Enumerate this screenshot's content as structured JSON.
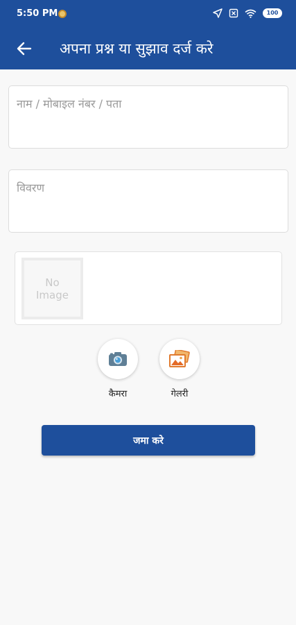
{
  "status_bar": {
    "time": "5:50 PM",
    "battery": "100",
    "icons": [
      "notification-dot-icon",
      "location-arrow-icon",
      "sim-off-icon",
      "wifi-icon",
      "battery-icon"
    ]
  },
  "header": {
    "title": "अपना प्रश्न या सुझाव दर्ज करे",
    "back_icon": "arrow-left-icon"
  },
  "form": {
    "name_placeholder": "नाम / मोबाइल नंबर / पता",
    "description_placeholder": "विवरण",
    "no_image_line1": "No",
    "no_image_line2": "Image"
  },
  "actions": {
    "camera_label": "कैमरा",
    "gallery_label": "गेलरी"
  },
  "submit_label": "जमा करे",
  "colors": {
    "primary": "#1e4f9c",
    "background": "#f8f8f8"
  }
}
